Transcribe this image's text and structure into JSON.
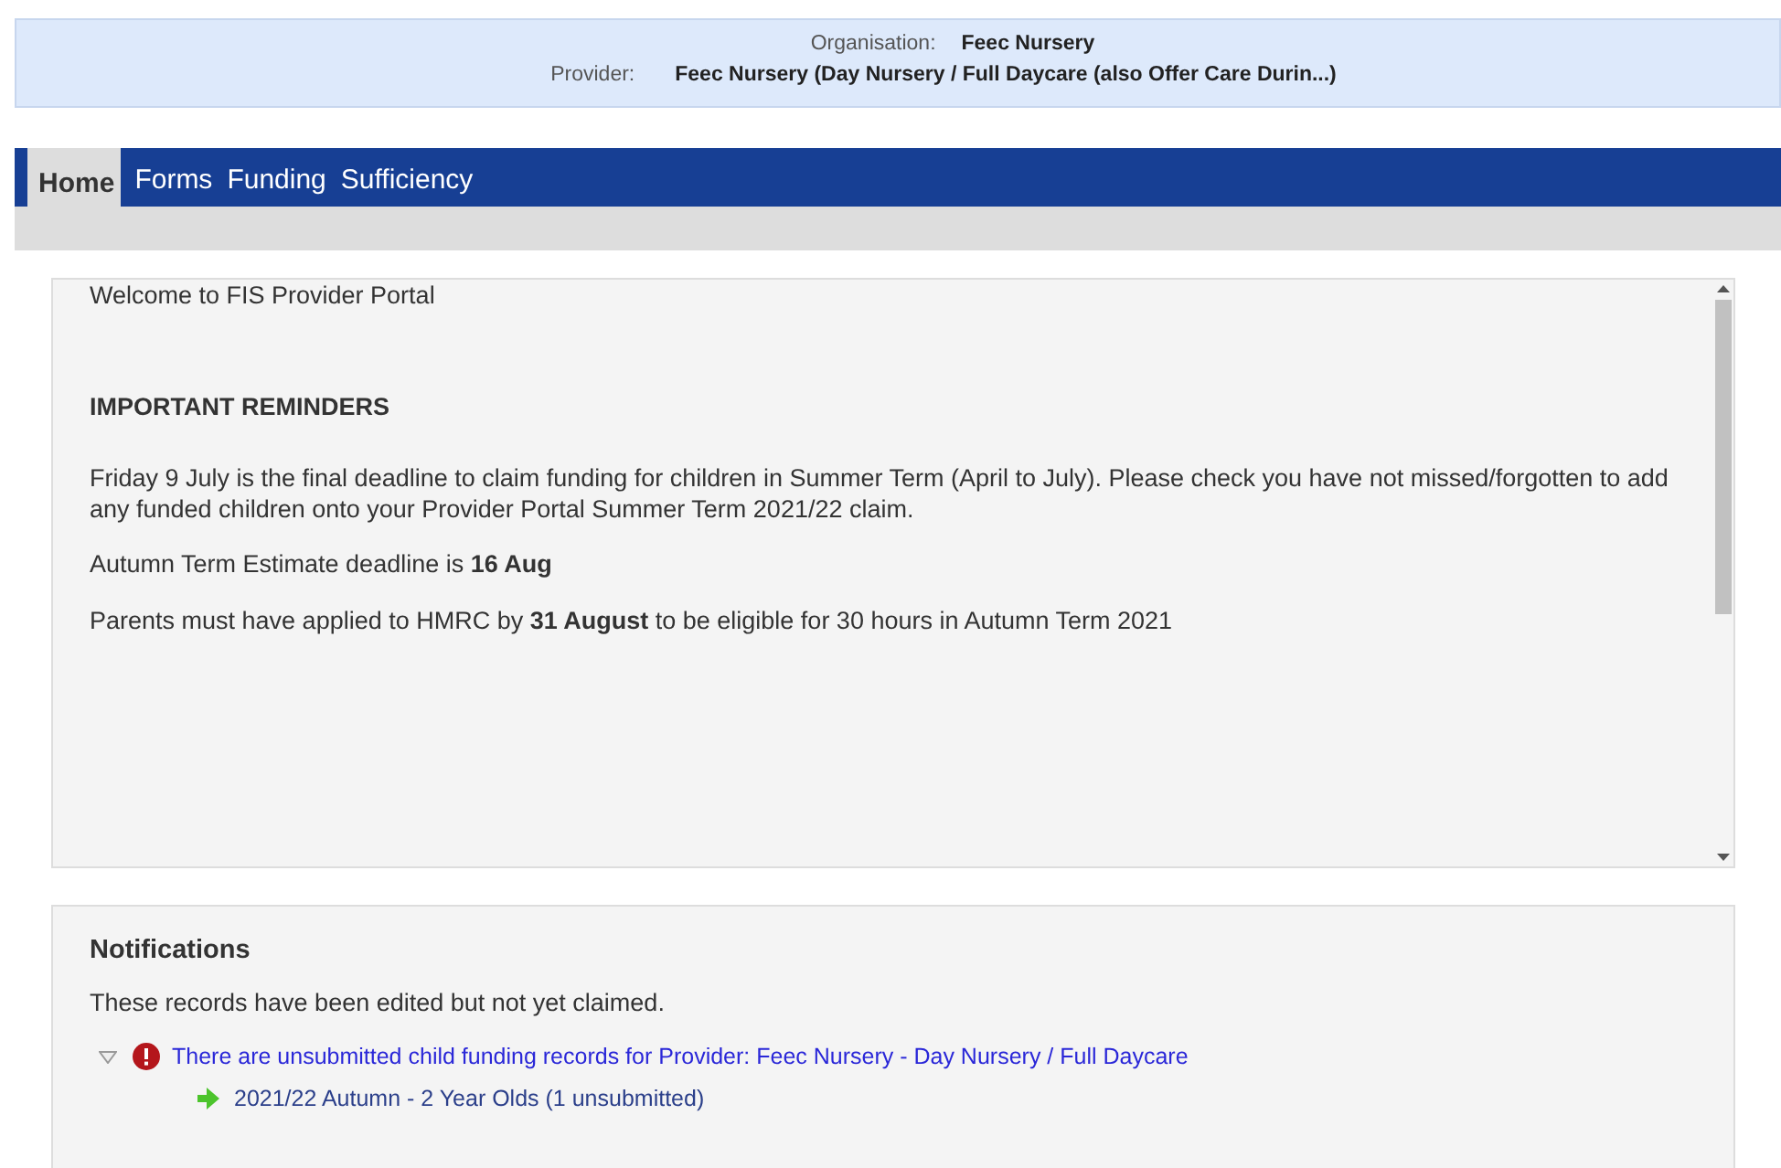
{
  "header": {
    "organisation_label": "Organisation:",
    "organisation": "Feec Nursery",
    "provider_label": "Provider:",
    "provider": "Feec Nursery (Day Nursery / Full Daycare (also Offer Care Durin...)"
  },
  "nav": [
    {
      "label": "Home",
      "selected": true
    },
    {
      "label": "Forms",
      "selected": false
    },
    {
      "label": "Funding",
      "selected": false
    },
    {
      "label": "Sufficiency",
      "selected": false
    }
  ],
  "welcome": {
    "title": "Welcome to FIS Provider Portal",
    "heading": "IMPORTANT REMINDERS",
    "paragraphs": [
      "Friday 9 July is the final deadline to claim funding for children in Summer Term (April to July). Please check you have not missed/forgotten to add any funded children onto your Provider Portal Summer Term 2021/22 claim.",
      "Autumn Term Estimate deadline is **16 Aug**",
      "Parents must have applied to HMRC by **31 August** to be eligible for 30 hours in Autumn Term 2021"
    ]
  },
  "notifications": {
    "title": "Notifications",
    "description": "These records have been edited but not yet claimed.",
    "items": [
      {
        "text": "There are unsubmitted child funding records for Provider: Feec Nursery - Day Nursery / Full Daycare",
        "expanded": true,
        "children": [
          {
            "text": "2021/22 Autumn - 2 Year Olds (1 unsubmitted)"
          }
        ]
      }
    ]
  }
}
